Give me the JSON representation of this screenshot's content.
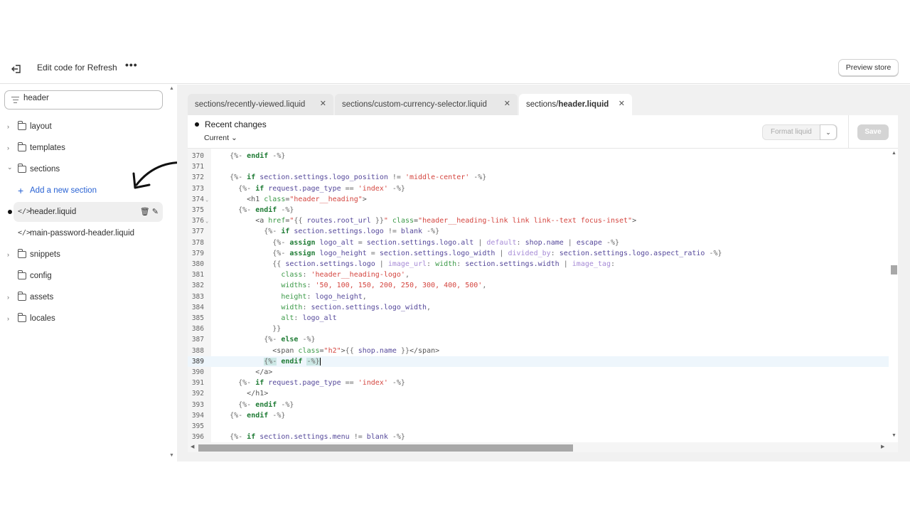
{
  "header": {
    "title": "Edit code for Refresh",
    "more_label": "•••",
    "preview_label": "Preview store"
  },
  "sidebar": {
    "search_value": "header",
    "folders": [
      {
        "label": "layout",
        "expanded": false
      },
      {
        "label": "templates",
        "expanded": false
      },
      {
        "label": "sections",
        "expanded": true
      },
      {
        "label": "snippets",
        "expanded": false
      },
      {
        "label": "config",
        "expanded": false
      },
      {
        "label": "assets",
        "expanded": false
      },
      {
        "label": "locales",
        "expanded": false
      }
    ],
    "add_section_label": "Add a new section",
    "files": [
      {
        "label": "header.liquid",
        "active": true,
        "modified": true
      },
      {
        "label": "main-password-header.liquid"
      }
    ]
  },
  "tabs": [
    {
      "label": "sections/recently-viewed.liquid"
    },
    {
      "label": "sections/custom-currency-selector.liquid"
    },
    {
      "label_prefix": "sections/",
      "label_bold": "header.liquid",
      "active": true
    }
  ],
  "toolbar": {
    "recent_changes": "Recent changes",
    "version": "Current",
    "format_label": "Format liquid",
    "save_label": "Save"
  },
  "editor": {
    "active_line": 389,
    "lines": [
      {
        "n": 370,
        "t": [
          [
            "d",
            "    {%-"
          ],
          [
            "k",
            " endif"
          ],
          [
            "d",
            " -%}"
          ]
        ]
      },
      {
        "n": 371,
        "t": []
      },
      {
        "n": 372,
        "t": [
          [
            "d",
            "    {%-"
          ],
          [
            "k",
            " if"
          ],
          [
            "v",
            " section.settings.logo_position"
          ],
          [
            "d",
            " !="
          ],
          [
            "s",
            " 'middle-center'"
          ],
          [
            "d",
            " -%}"
          ]
        ]
      },
      {
        "n": 373,
        "t": [
          [
            "d",
            "      {%-"
          ],
          [
            "k",
            " if"
          ],
          [
            "v",
            " request.page_type"
          ],
          [
            "d",
            " =="
          ],
          [
            "s",
            " 'index'"
          ],
          [
            "d",
            " -%}"
          ]
        ]
      },
      {
        "n": 374,
        "fold": true,
        "t": [
          [
            "t",
            "        <h1"
          ],
          [
            "a",
            " class"
          ],
          [
            "t",
            "="
          ],
          [
            "s",
            "\"header__heading\""
          ],
          [
            "t",
            ">"
          ]
        ]
      },
      {
        "n": 375,
        "t": [
          [
            "d",
            "      {%-"
          ],
          [
            "k",
            " endif"
          ],
          [
            "d",
            " -%}"
          ]
        ]
      },
      {
        "n": 376,
        "fold": true,
        "t": [
          [
            "t",
            "          <a"
          ],
          [
            "a",
            " href"
          ],
          [
            "t",
            "="
          ],
          [
            "s",
            "\""
          ],
          [
            "d",
            "{{"
          ],
          [
            "v",
            " routes.root_url"
          ],
          [
            "d",
            " }}"
          ],
          [
            "s",
            "\""
          ],
          [
            "a",
            " class"
          ],
          [
            "t",
            "="
          ],
          [
            "s",
            "\"header__heading-link link link--text focus-inset\""
          ],
          [
            "t",
            ">"
          ]
        ]
      },
      {
        "n": 377,
        "t": [
          [
            "d",
            "            {%-"
          ],
          [
            "k",
            " if"
          ],
          [
            "v",
            " section.settings.logo"
          ],
          [
            "d",
            " !="
          ],
          [
            "v",
            " blank"
          ],
          [
            "d",
            " -%}"
          ]
        ]
      },
      {
        "n": 378,
        "t": [
          [
            "d",
            "              {%-"
          ],
          [
            "k",
            " assign"
          ],
          [
            "v",
            " logo_alt"
          ],
          [
            "d",
            " ="
          ],
          [
            "v",
            " section.settings.logo.alt"
          ],
          [
            "d",
            " |"
          ],
          [
            "f",
            " default"
          ],
          [
            "d",
            ":"
          ],
          [
            "v",
            " shop.name"
          ],
          [
            "d",
            " |"
          ],
          [
            "v",
            " escape"
          ],
          [
            "d",
            " -%}"
          ]
        ]
      },
      {
        "n": 379,
        "t": [
          [
            "d",
            "              {%-"
          ],
          [
            "k",
            " assign"
          ],
          [
            "v",
            " logo_height"
          ],
          [
            "d",
            " ="
          ],
          [
            "v",
            " section.settings.logo_width"
          ],
          [
            "d",
            " |"
          ],
          [
            "f",
            " divided_by"
          ],
          [
            "d",
            ":"
          ],
          [
            "v",
            " section.settings.logo.aspect_ratio"
          ],
          [
            "d",
            " -%}"
          ]
        ]
      },
      {
        "n": 380,
        "t": [
          [
            "d",
            "              {{"
          ],
          [
            "v",
            " section.settings.logo"
          ],
          [
            "d",
            " |"
          ],
          [
            "f",
            " image_url"
          ],
          [
            "d",
            ":"
          ],
          [
            "a",
            " width"
          ],
          [
            "d",
            ":"
          ],
          [
            "v",
            " section.settings.width"
          ],
          [
            "d",
            " |"
          ],
          [
            "f",
            " image_tag"
          ],
          [
            "d",
            ":"
          ]
        ]
      },
      {
        "n": 381,
        "t": [
          [
            "a",
            "                class"
          ],
          [
            "d",
            ":"
          ],
          [
            "s",
            " 'header__heading-logo'"
          ],
          [
            "d",
            ","
          ]
        ]
      },
      {
        "n": 382,
        "t": [
          [
            "a",
            "                widths"
          ],
          [
            "d",
            ":"
          ],
          [
            "s",
            " '50, 100, 150, 200, 250, 300, 400, 500'"
          ],
          [
            "d",
            ","
          ]
        ]
      },
      {
        "n": 383,
        "t": [
          [
            "a",
            "                height"
          ],
          [
            "d",
            ":"
          ],
          [
            "v",
            " logo_height"
          ],
          [
            "d",
            ","
          ]
        ]
      },
      {
        "n": 384,
        "t": [
          [
            "a",
            "                width"
          ],
          [
            "d",
            ":"
          ],
          [
            "v",
            " section.settings.logo_width"
          ],
          [
            "d",
            ","
          ]
        ]
      },
      {
        "n": 385,
        "t": [
          [
            "a",
            "                alt"
          ],
          [
            "d",
            ":"
          ],
          [
            "v",
            " logo_alt"
          ]
        ]
      },
      {
        "n": 386,
        "t": [
          [
            "d",
            "              }}"
          ]
        ]
      },
      {
        "n": 387,
        "t": [
          [
            "d",
            "            {%-"
          ],
          [
            "k",
            " else"
          ],
          [
            "d",
            " -%}"
          ]
        ]
      },
      {
        "n": 388,
        "t": [
          [
            "t",
            "              <span"
          ],
          [
            "a",
            " class"
          ],
          [
            "t",
            "="
          ],
          [
            "s",
            "\"h2\""
          ],
          [
            "t",
            ">"
          ],
          [
            "d",
            "{{"
          ],
          [
            "v",
            " shop.name"
          ],
          [
            "d",
            " }}"
          ],
          [
            "t",
            "</span>"
          ]
        ]
      },
      {
        "n": 389,
        "t": [
          [
            "p",
            "            "
          ],
          [
            "dm",
            "{%-"
          ],
          [
            "k",
            " endif"
          ],
          [
            "p",
            " "
          ],
          [
            "dm",
            "-%}"
          ]
        ]
      },
      {
        "n": 390,
        "t": [
          [
            "t",
            "          </a>"
          ]
        ]
      },
      {
        "n": 391,
        "t": [
          [
            "d",
            "      {%-"
          ],
          [
            "k",
            " if"
          ],
          [
            "v",
            " request.page_type"
          ],
          [
            "d",
            " =="
          ],
          [
            "s",
            " 'index'"
          ],
          [
            "d",
            " -%}"
          ]
        ]
      },
      {
        "n": 392,
        "t": [
          [
            "t",
            "        </h1>"
          ]
        ]
      },
      {
        "n": 393,
        "t": [
          [
            "d",
            "      {%-"
          ],
          [
            "k",
            " endif"
          ],
          [
            "d",
            " -%}"
          ]
        ]
      },
      {
        "n": 394,
        "t": [
          [
            "d",
            "    {%-"
          ],
          [
            "k",
            " endif"
          ],
          [
            "d",
            " -%}"
          ]
        ]
      },
      {
        "n": 395,
        "t": []
      },
      {
        "n": 396,
        "t": [
          [
            "d",
            "    {%-"
          ],
          [
            "k",
            " if"
          ],
          [
            "v",
            " section.settings.menu"
          ],
          [
            "d",
            " !="
          ],
          [
            "v",
            " blank"
          ],
          [
            "d",
            " -%}"
          ]
        ]
      }
    ]
  }
}
